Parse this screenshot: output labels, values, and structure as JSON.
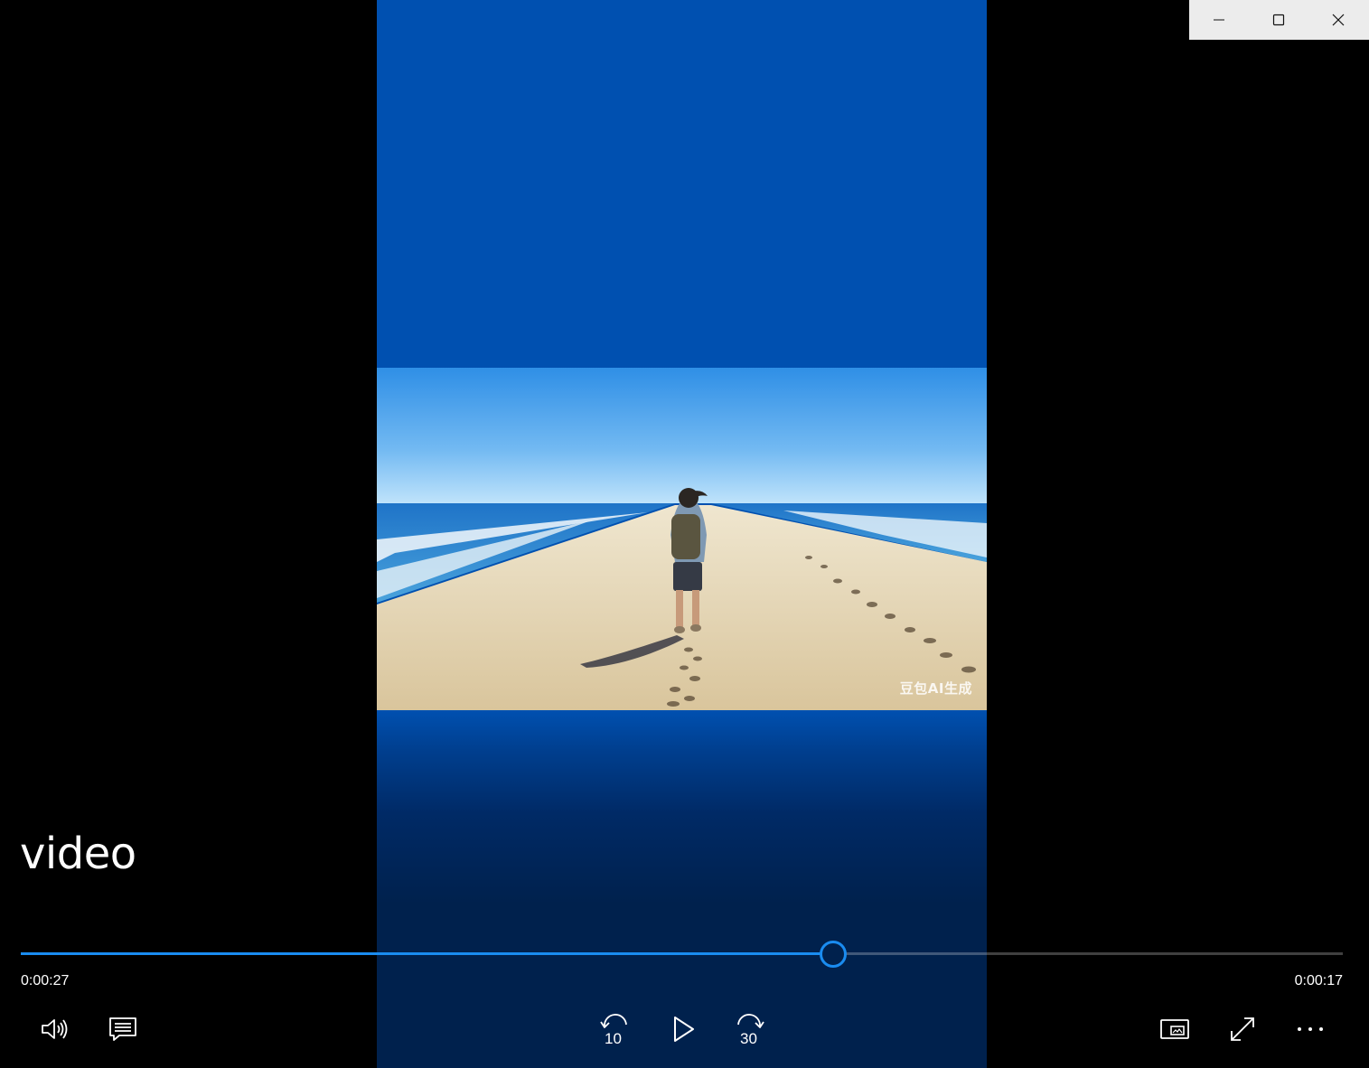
{
  "window": {
    "minimize_icon": "minimize-icon",
    "maximize_icon": "maximize-icon",
    "close_icon": "close-icon"
  },
  "video": {
    "title": "video",
    "watermark": "豆包AI生成"
  },
  "playback": {
    "elapsed": "0:00:27",
    "remaining": "0:00:17",
    "progress_fraction": 0.6136,
    "accent_color": "#1a8cf0"
  },
  "controls": {
    "volume_icon": "volume-icon",
    "subtitles_icon": "subtitles-icon",
    "skip_back_seconds": "10",
    "play_icon": "play-icon",
    "skip_forward_seconds": "30",
    "mini_view_icon": "mini-view-icon",
    "fullscreen_icon": "fullscreen-icon",
    "more_icon": "more-options-icon"
  }
}
